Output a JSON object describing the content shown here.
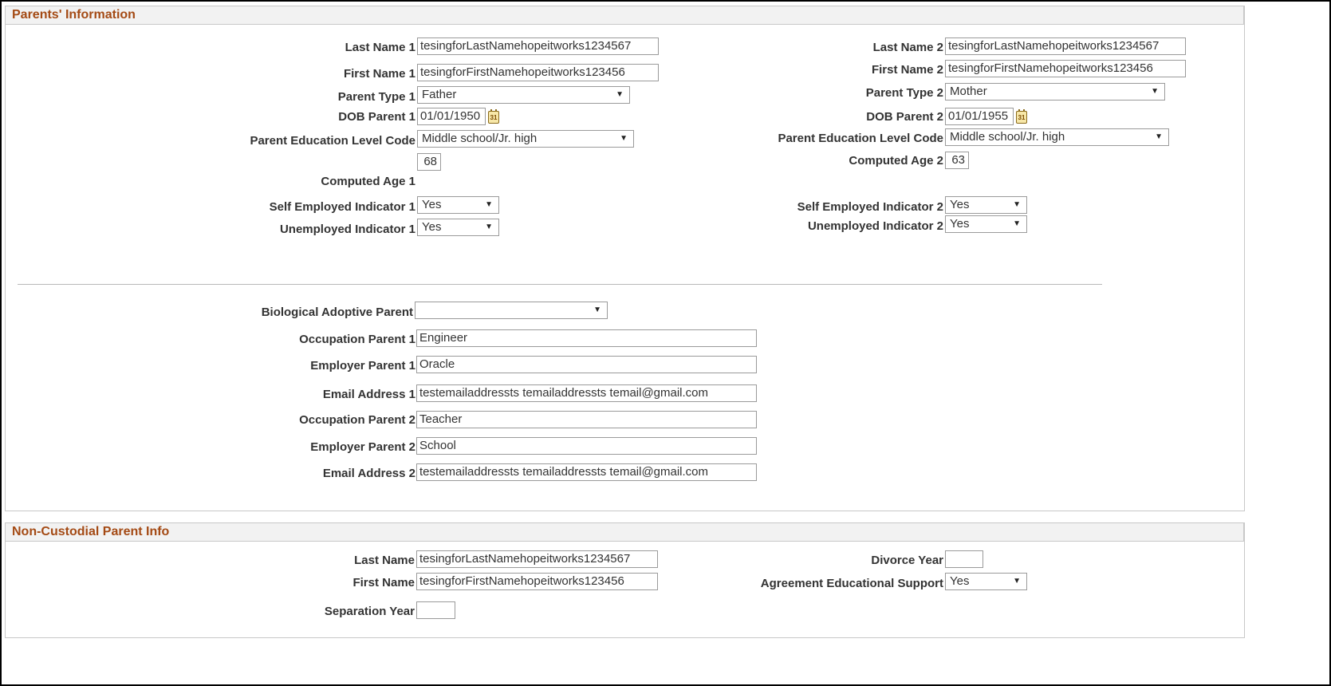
{
  "parents": {
    "header": "Parents' Information",
    "last_name_1_label": "Last Name 1",
    "last_name_1_value": "tesingforLastNamehopeitworks1234567",
    "first_name_1_label": "First Name 1",
    "first_name_1_value": "tesingforFirstNamehopeitworks123456",
    "parent_type_1_label": "Parent Type 1",
    "parent_type_1_value": "Father",
    "dob_1_label": "DOB Parent 1",
    "dob_1_value": "01/01/1950",
    "edu_1_label": "Parent Education Level Code",
    "edu_1_value": "Middle school/Jr. high",
    "age_1_value": "68",
    "age_1_label": "Computed Age 1",
    "self_emp_1_label": "Self Employed Indicator 1",
    "self_emp_1_value": "Yes",
    "unemp_1_label": "Unemployed Indicator 1",
    "unemp_1_value": "Yes",
    "last_name_2_label": "Last Name 2",
    "last_name_2_value": "tesingforLastNamehopeitworks1234567",
    "first_name_2_label": "First Name 2",
    "first_name_2_value": "tesingforFirstNamehopeitworks123456",
    "parent_type_2_label": "Parent Type 2",
    "parent_type_2_value": "Mother",
    "dob_2_label": "DOB Parent 2",
    "dob_2_value": "01/01/1955",
    "edu_2_label": "Parent Education Level Code",
    "edu_2_value": "Middle school/Jr. high",
    "age_2_label": "Computed Age 2",
    "age_2_value": "63",
    "self_emp_2_label": "Self Employed Indicator 2",
    "self_emp_2_value": "Yes",
    "unemp_2_label": "Unemployed Indicator 2",
    "unemp_2_value": "Yes",
    "bio_label": "Biological Adoptive Parent",
    "bio_value": "",
    "occupation_1_label": "Occupation Parent 1",
    "occupation_1_value": "Engineer",
    "employer_1_label": "Employer Parent 1",
    "employer_1_value": "Oracle",
    "email_1_label": "Email Address 1",
    "email_1_value": "testemailaddressts temailaddressts temail@gmail.com",
    "occupation_2_label": "Occupation Parent 2",
    "occupation_2_value": "Teacher",
    "employer_2_label": "Employer Parent 2",
    "employer_2_value": "School",
    "email_2_label": "Email Address 2",
    "email_2_value": "testemailaddressts temailaddressts temail@gmail.com"
  },
  "noncustodial": {
    "header": "Non-Custodial Parent Info",
    "last_name_label": "Last Name",
    "last_name_value": "tesingforLastNamehopeitworks1234567",
    "first_name_label": "First Name",
    "first_name_value": "tesingforFirstNamehopeitworks123456",
    "separation_year_label": "Separation Year",
    "separation_year_value": "",
    "divorce_year_label": "Divorce Year",
    "divorce_year_value": "",
    "agreement_label": "Agreement Educational Support",
    "agreement_value": "Yes"
  },
  "icons": {
    "calendar": "calendar-icon",
    "dropdown": "chevron-down-icon",
    "calendar_glyph": "31",
    "dropdown_glyph": "▼"
  },
  "colors": {
    "header_text": "#a44a14",
    "header_bg": "#f2f2f2"
  }
}
